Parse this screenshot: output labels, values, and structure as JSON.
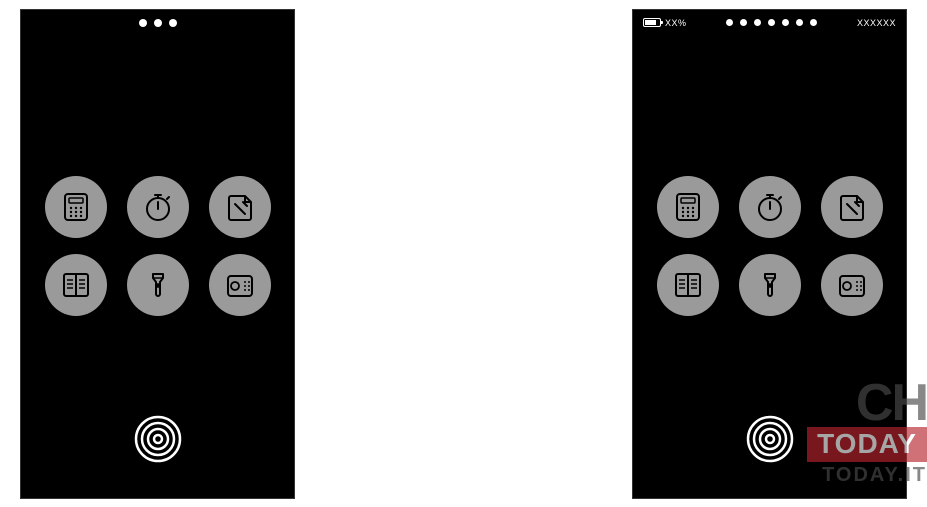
{
  "phoneA": {
    "pageDots": 3
  },
  "phoneB": {
    "batteryText": "XX%",
    "timeText": "XXXXXX",
    "pageDots": 7
  },
  "apps": {
    "calculator": "calculator-icon",
    "stopwatch": "stopwatch-icon",
    "notes": "notes-icon",
    "contacts": "contacts-icon",
    "flashlight": "flashlight-icon",
    "radio": "radio-icon"
  },
  "watermark": {
    "line1": "CH",
    "line2": "TODAY",
    "line3": "TODAY.IT"
  }
}
